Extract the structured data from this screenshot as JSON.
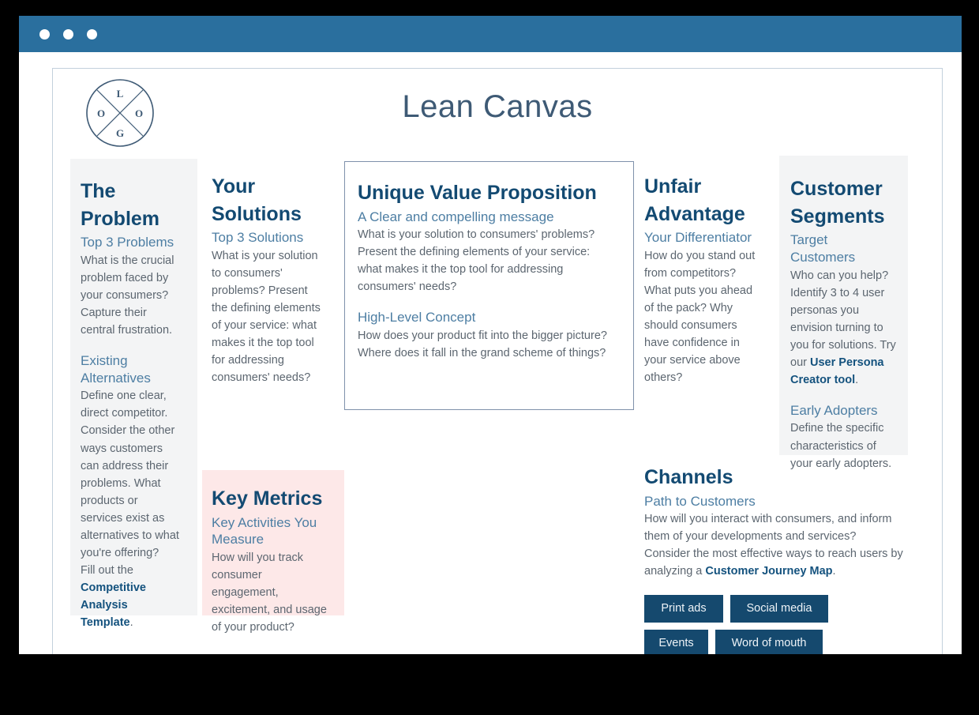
{
  "window": {
    "dots": [
      "close-dot",
      "minimize-dot",
      "maximize-dot"
    ],
    "titlebar_color": "#2a6f9e"
  },
  "logo": {
    "letters": {
      "top": "L",
      "left": "O",
      "right": "O",
      "bottom": "G"
    },
    "name": "logo-mark"
  },
  "canvas": {
    "title": "Lean Canvas"
  },
  "blocks": {
    "problem": {
      "title": "The Problem",
      "sub1": "Top 3 Problems",
      "body1": "What is the crucial problem faced by your consumers? Capture their central frustration.",
      "sub2": "Existing Alternatives",
      "body2": "Define one clear, direct competitor. Consider the other ways customers can address their problems. What products or services exist as alternatives to what you're offering?",
      "body3_pre": "Fill out the ",
      "body3_link": "Competitive Analysis Template",
      "body3_post": ".",
      "background": "#f3f4f5"
    },
    "solutions": {
      "title": "Your Solutions",
      "sub1": "Top 3 Solutions",
      "body1": "What is your solution to consumers' problems? Present the defining elements of your service: what makes it the top tool for addressing consumers' needs?"
    },
    "uvp": {
      "title": "Unique Value Proposition",
      "sub1": "A Clear and compelling message",
      "body1": "What is your solution to consumers' problems? Present the defining elements of your service: what makes it the top tool for addressing consumers' needs?",
      "sub2": "High-Level Concept",
      "body2": "How does your product fit into the bigger picture? Where does it fall in the grand scheme of things?",
      "border_color": "#7f91ab"
    },
    "unfair": {
      "title": "Unfair Advantage",
      "sub1": "Your Differentiator",
      "body1": "How do you stand out from competitors? What puts you ahead of the pack? Why should consumers have confidence in your service above others?"
    },
    "segments": {
      "title": "Customer Segments",
      "sub1": "Target Customers",
      "body1_pre": "Who can you help? Identify 3 to 4 user personas you envision turning to you for solutions. Try our ",
      "body1_link": "User Persona Creator tool",
      "body1_post": ".",
      "sub2": "Early Adopters",
      "body2": "Define the specific characteristics of your early adopters.",
      "background": "#f3f4f5"
    },
    "metrics": {
      "title": "Key Metrics",
      "sub1": "Key Activities You Measure",
      "body1": "How will you track consumer engagement, excitement, and usage of your product?",
      "background": "#fde8e8"
    },
    "channels": {
      "title": "Channels",
      "sub1": "Path to Customers",
      "body1_pre": "How will you interact with consumers, and inform them of your developments and services? Consider the most effective ways to reach users by analyzing a ",
      "body1_link": "Customer Journey Map",
      "body1_post": ".",
      "chips": [
        "Print ads",
        "Social media",
        "Events",
        "Word of mouth"
      ]
    }
  },
  "colors": {
    "title_navy": "#134a72",
    "subtitle_blue": "#4d7ea3",
    "body_gray": "#5c6670",
    "chip_navy": "#15496e",
    "frame_border": "#c3d0dc"
  }
}
